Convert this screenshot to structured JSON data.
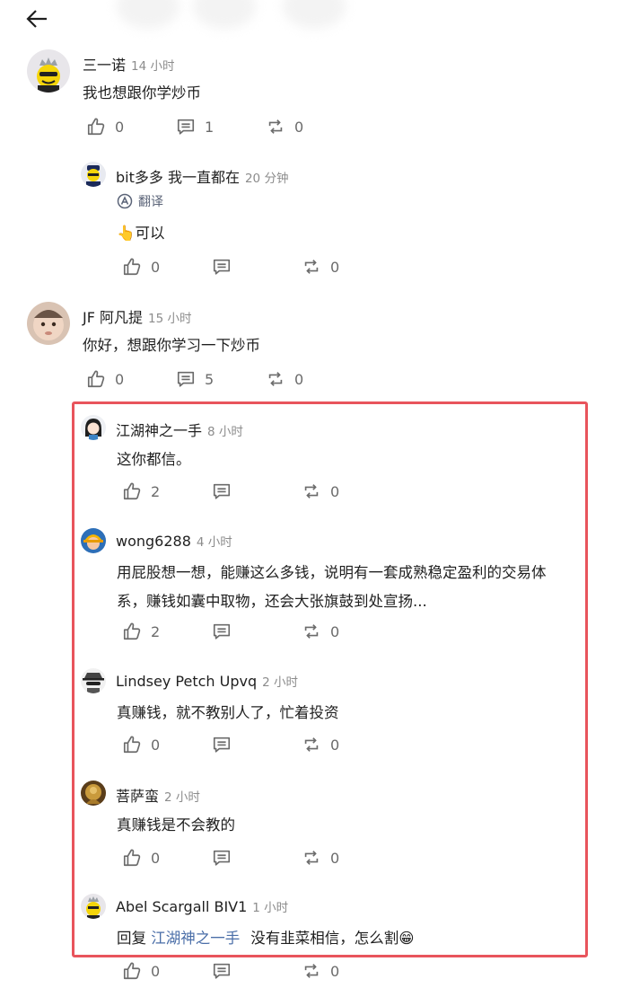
{
  "nav": {
    "back_icon": "arrow-left-icon"
  },
  "comments": [
    {
      "user": "三一诺",
      "time": "14 小时",
      "text": "我也想跟你学炒币",
      "likes": "0",
      "replies": "1",
      "reposts": "0",
      "avatar_icon": "crowned-yellow-character-avatar"
    },
    {
      "user": "bit多多 我一直都在",
      "time": "20 分钟",
      "translate": "翻译",
      "text_emoji": "👆",
      "text": "可以",
      "likes": "0",
      "reposts": "0",
      "avatar_icon": "police-character-avatar"
    },
    {
      "user": "JF 阿凡提",
      "time": "15 小时",
      "text": "你好，想跟你学习一下炒币",
      "likes": "0",
      "replies": "5",
      "reposts": "0",
      "avatar_icon": "baby-photo-avatar"
    },
    {
      "user": "江湖神之一手",
      "time": "8 小时",
      "text": "这你都信。",
      "likes": "2",
      "reposts": "0",
      "avatar_icon": "girl-cartoon-avatar"
    },
    {
      "user": "wong6288",
      "time": "4 小时",
      "text_line1": "用屁股想一想，能赚这么多钱，说明有一套成熟稳定盈利的交易体",
      "text_line2": "系，赚钱如囊中取物，还会大张旗鼓到处宣扬...",
      "likes": "2",
      "reposts": "0",
      "avatar_icon": "yellow-hat-character-avatar"
    },
    {
      "user": "Lindsey Petch Upvq",
      "time": "2 小时",
      "text": "真赚钱，就不教别人了，忙着投资",
      "likes": "0",
      "reposts": "0",
      "avatar_icon": "spy-hat-avatar"
    },
    {
      "user": "菩萨蛮",
      "time": "2 小时",
      "text": "真赚钱是不会教的",
      "likes": "0",
      "reposts": "0",
      "avatar_icon": "golden-buddha-avatar"
    },
    {
      "user": "Abel Scargall BIV1",
      "time": "1 小时",
      "reply_prefix": "回复",
      "mention": "江湖神之一手",
      "text": "没有韭菜相信，怎么割",
      "text_emoji": "😁",
      "likes": "0",
      "reposts": "0",
      "avatar_icon": "sunglasses-character-avatar"
    }
  ],
  "colors": {
    "highlight": "#e8545c",
    "mention": "#4a6ea8",
    "muted": "#8c8c8c"
  }
}
